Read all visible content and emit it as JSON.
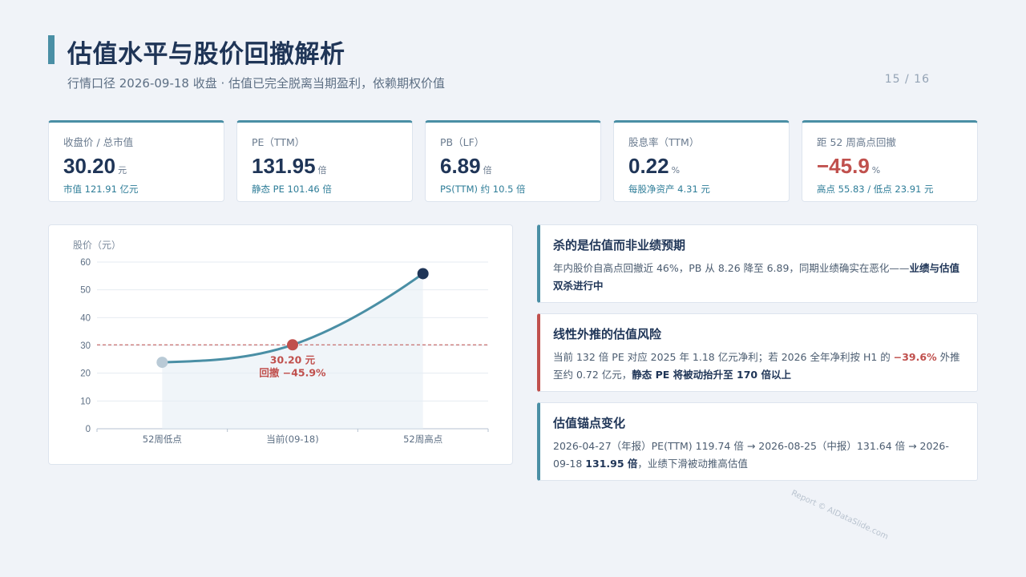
{
  "header": {
    "title": "估值水平与股价回撤解析",
    "subtitle": "行情口径 2026-09-18 收盘 · 估值已完全脱离当期盈利，依赖期权价值",
    "page": "15 / 16"
  },
  "kpis": [
    {
      "label": "收盘价 / 总市值",
      "value": "30.20",
      "unit": "元",
      "sub": "市值 121.91 亿元",
      "negative": false
    },
    {
      "label": "PE（TTM）",
      "value": "131.95",
      "unit": "倍",
      "sub": "静态 PE 101.46 倍",
      "negative": false
    },
    {
      "label": "PB（LF）",
      "value": "6.89",
      "unit": "倍",
      "sub": "PS(TTM) 约 10.5 倍",
      "negative": false
    },
    {
      "label": "股息率（TTM）",
      "value": "0.22",
      "unit": "%",
      "sub": "每股净资产 4.31 元",
      "negative": false
    },
    {
      "label": "距 52 周高点回撤",
      "value": "−45.9",
      "unit": "%",
      "sub": "高点 55.83 / 低点 23.91 元",
      "negative": true
    }
  ],
  "chart_data": {
    "type": "line",
    "ylabel": "股价（元）",
    "categories": [
      "52周低点",
      "当前(09-18)",
      "52周高点"
    ],
    "values": [
      23.91,
      30.2,
      55.83
    ],
    "ylim": [
      0,
      60
    ],
    "yticks": [
      0,
      10,
      20,
      30,
      40,
      50,
      60
    ],
    "reference_line": 30.2,
    "annotation": {
      "line1": "30.20 元",
      "line2": "回撤 −45.9%"
    },
    "grid": true,
    "colors": {
      "line": "#4a8fa5",
      "low": "#b9cad6",
      "current": "#c0504d",
      "high": "#1f3557",
      "ref": "#c0504d"
    }
  },
  "insights": [
    {
      "title": "杀的是估值而非业绩预期",
      "body_plain": "年内股价自高点回撤近 46%，PB 从 8.26 降至 6.89，同期业绩确实在恶化——",
      "body_bold": "业绩与估值双杀进行中"
    },
    {
      "title": "线性外推的估值风险",
      "body_a": "当前 132 倍 PE 对应 2025 年 1.18 亿元净利；若 2026 全年净利按 H1 的 ",
      "body_hl": "−39.6%",
      "body_b": " 外推至约 0.72 亿元，",
      "body_bold": "静态 PE 将被动抬升至 170 倍以上"
    },
    {
      "title": "估值锚点变化",
      "body_a": "2026-04-27（年报）PE(TTM) 119.74 倍 → 2026-08-25（中报）131.64 倍 → 2026-09-18 ",
      "body_bold": "131.95 倍",
      "body_b": "，业绩下滑被动推高估值"
    }
  ],
  "watermark": "Report © AIDataSlide.com"
}
